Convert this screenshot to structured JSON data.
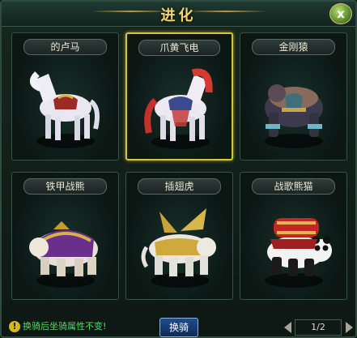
{
  "window": {
    "title": "进化",
    "close_label": "x"
  },
  "mounts": [
    {
      "name": "的卢马",
      "icon": "white-horse-icon",
      "selected": false
    },
    {
      "name": "爪黄飞电",
      "icon": "red-mane-horse-icon",
      "selected": true
    },
    {
      "name": "金刚猿",
      "icon": "armored-ape-icon",
      "selected": false
    },
    {
      "name": "铁甲战熊",
      "icon": "armored-bear-icon",
      "selected": false
    },
    {
      "name": "插翅虎",
      "icon": "winged-tiger-icon",
      "selected": false
    },
    {
      "name": "战歌熊猫",
      "icon": "war-panda-icon",
      "selected": false
    }
  ],
  "footer": {
    "tip": "换骑后坐骑属性不变!",
    "tip_icon": "!",
    "ride_button": "换骑",
    "page": "1/2"
  }
}
